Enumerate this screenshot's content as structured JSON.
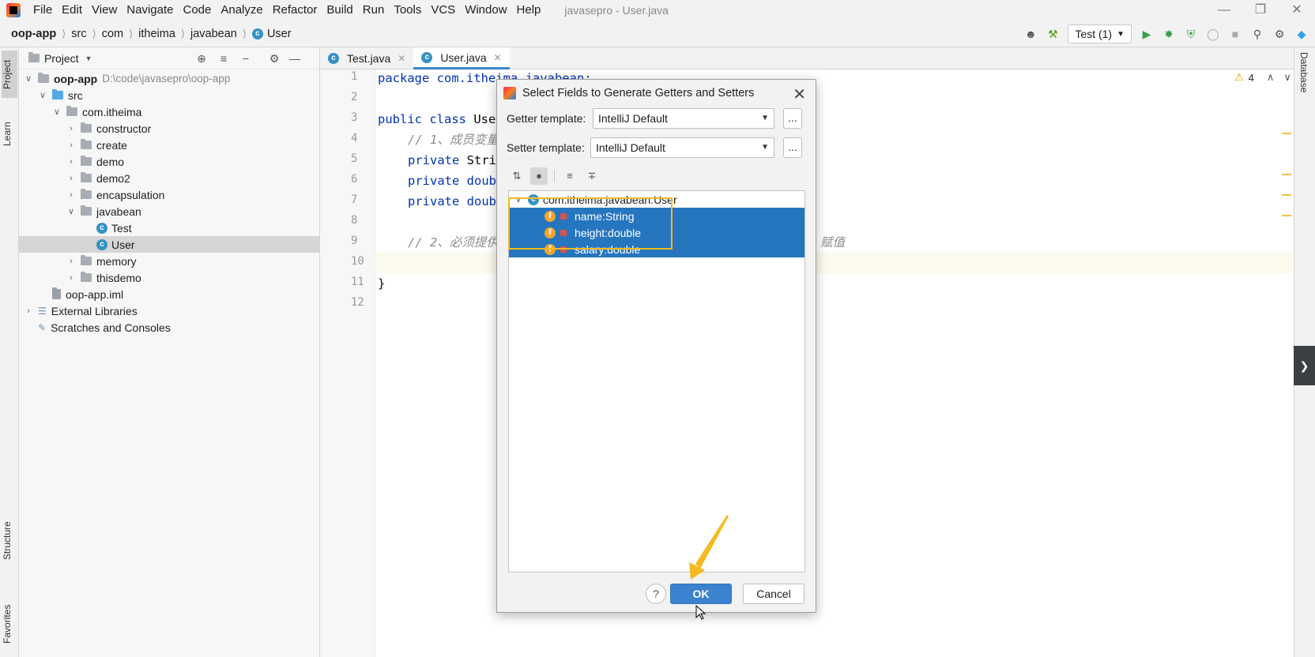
{
  "menu": {
    "items": [
      "File",
      "Edit",
      "View",
      "Navigate",
      "Code",
      "Analyze",
      "Refactor",
      "Build",
      "Run",
      "Tools",
      "VCS",
      "Window",
      "Help"
    ],
    "window_title": "javasepro - User.java"
  },
  "breadcrumb": [
    "oop-app",
    "src",
    "com",
    "itheima",
    "javabean",
    "User"
  ],
  "toolbar": {
    "run_config": "Test (1)"
  },
  "left_strip": {
    "project": "Project",
    "learn": "Learn",
    "structure": "Structure",
    "favorites": "Favorites"
  },
  "right_strip": {
    "database": "Database"
  },
  "project_panel": {
    "title": "Project",
    "tree": [
      {
        "label": "oop-app",
        "extra": "D:\\code\\javasepro\\oop-app"
      },
      {
        "label": "src"
      },
      {
        "label": "com.itheima"
      },
      {
        "label": "constructor"
      },
      {
        "label": "create"
      },
      {
        "label": "demo"
      },
      {
        "label": "demo2"
      },
      {
        "label": "encapsulation"
      },
      {
        "label": "javabean"
      },
      {
        "label": "Test"
      },
      {
        "label": "User"
      },
      {
        "label": "memory"
      },
      {
        "label": "thisdemo"
      },
      {
        "label": "oop-app.iml"
      },
      {
        "label": "External Libraries"
      },
      {
        "label": "Scratches and Consoles"
      }
    ]
  },
  "editor": {
    "tabs": [
      "Test.java",
      "User.java"
    ],
    "warnings": "4",
    "line_numbers": [
      "1",
      "2",
      "3",
      "4",
      "5",
      "6",
      "7",
      "8",
      "9",
      "10",
      "11",
      "12"
    ],
    "lines": {
      "l1": "package com.itheima.javabean;",
      "l3_kw": "public class ",
      "l3_name": "User",
      "l4": "// 1、成员变量",
      "l5_kw": "private ",
      "l5_type": "Stri",
      "l6_kw": "private ",
      "l6_type": "doub",
      "l7_kw": "private ",
      "l7_type": "doub",
      "l9": "// 2、必须提供",
      "l9_tail": "赋值",
      "l11": "}"
    }
  },
  "dialog": {
    "title": "Select Fields to Generate Getters and Setters",
    "getter_label": "Getter template:",
    "getter_value": "IntelliJ Default",
    "setter_label": "Setter template:",
    "setter_value": "IntelliJ Default",
    "more": "...",
    "class_node": "com.itheima.javabean.User",
    "fields": [
      "name:String",
      "height:double",
      "salary:double"
    ],
    "help": "?",
    "ok": "OK",
    "cancel": "Cancel"
  }
}
